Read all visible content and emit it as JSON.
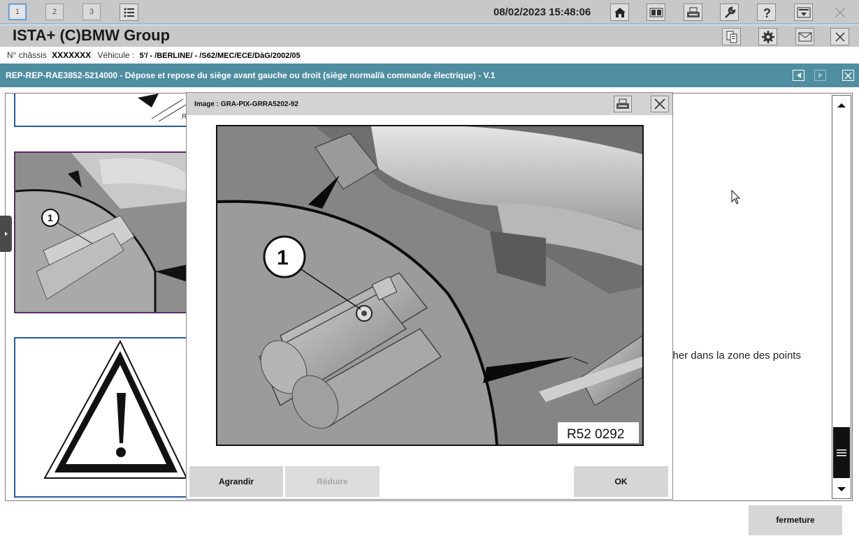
{
  "toolbar": {
    "tabs": [
      "1",
      "2",
      "3"
    ],
    "datetime": "08/02/2023 15:48:06",
    "icons": [
      "list-icon",
      "home-icon",
      "split-view-icon",
      "print-icon",
      "wrench-icon",
      "help-icon",
      "download-icon",
      "close-icon"
    ]
  },
  "titlebar": {
    "title": "ISTA+ (C)BMW Group",
    "icons": [
      "document-icon",
      "gear-icon",
      "mail-icon",
      "close-icon"
    ]
  },
  "vehicle": {
    "chassis_label": "N° châssis",
    "chassis_value": "XXXXXXX",
    "vehicle_label": "Véhicule :",
    "vehicle_value": "5'/ - /BERLINE/ - /S62/MEC/ECE/DàG/2002/05"
  },
  "document": {
    "title": "REP-REP-RAE3852-5214000 - Dépose et repose du siège avant gauche ou droit (siège normal/à commande électrique) - V.1"
  },
  "content": {
    "background_text": "cher dans la zone des points",
    "callout_left": "1"
  },
  "modal": {
    "title": "Image : GRA-PIX-GRRA5202-92",
    "callout": "1",
    "image_ref": "R52 0292",
    "buttons": {
      "enlarge": "Agrandir",
      "reduce": "Réduire",
      "ok": "OK"
    }
  },
  "footer": {
    "close_label": "fermeture"
  },
  "colors": {
    "header_teal": "#4f8ea0",
    "toolbar_gray": "#c8c8c8",
    "accent_blue": "#4a90d9"
  }
}
